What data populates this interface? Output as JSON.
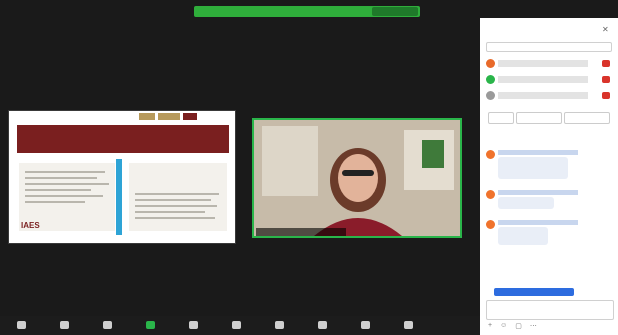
{
  "notification": {
    "text": "",
    "action_label": ""
  },
  "meeting": {
    "top_left_label": "",
    "top_right_label": "",
    "shared_slide": {
      "title_text": "",
      "footer_logo": "IAES"
    },
    "speaker": {
      "banner_text": "",
      "name_label": ""
    }
  },
  "toolbar": {
    "items": [
      {
        "label": "",
        "icon": "microphone-icon"
      },
      {
        "label": "",
        "icon": "video-camera-icon"
      },
      {
        "label": "",
        "icon": "security-shield-icon"
      },
      {
        "label": "",
        "icon": "participants-icon",
        "active": true
      },
      {
        "label": "",
        "icon": "chat-icon"
      },
      {
        "label": "",
        "icon": "share-screen-icon"
      },
      {
        "label": "",
        "icon": "record-icon"
      },
      {
        "label": "",
        "icon": "reactions-icon"
      },
      {
        "label": "",
        "icon": "apps-icon"
      },
      {
        "label": "",
        "icon": "more-icon"
      }
    ],
    "end_label": ""
  },
  "participants_panel": {
    "title": "",
    "search_placeholder": "",
    "participants": [
      {
        "name": "",
        "avatar_color": "#e86a2a"
      },
      {
        "name": "",
        "avatar_color": "#2ab54a"
      },
      {
        "name": "",
        "avatar_color": "#9a9a9a"
      }
    ],
    "actions": [
      {
        "label": ""
      },
      {
        "label": ""
      },
      {
        "label": ""
      }
    ]
  },
  "chat": {
    "title": "",
    "messages": [
      {
        "text": ""
      },
      {
        "text": ""
      },
      {
        "text": ""
      }
    ],
    "to_label": "",
    "input_placeholder": ""
  },
  "colors": {
    "accent_green": "#2ab54a",
    "end_red": "#d9342b",
    "slide_maroon": "#7a1f1f",
    "slide_blue": "#2ea4d6"
  }
}
